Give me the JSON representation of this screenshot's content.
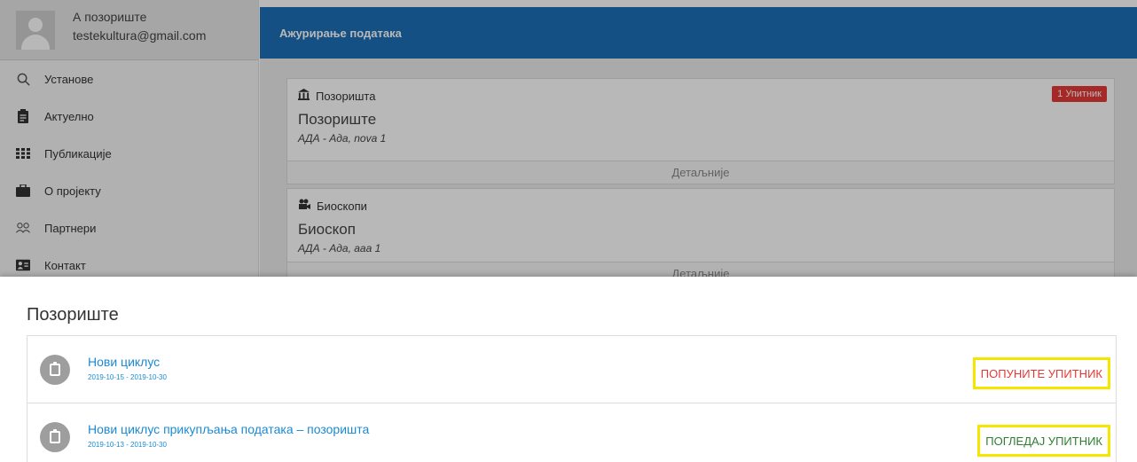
{
  "profile": {
    "name": "А позориште",
    "email": "testekultura@gmail.com"
  },
  "sidebar": {
    "items": [
      {
        "label": "Установе",
        "icon": "search-icon"
      },
      {
        "label": "Актуелно",
        "icon": "clipboard-icon"
      },
      {
        "label": "Публикације",
        "icon": "grid-icon"
      },
      {
        "label": "О пројекту",
        "icon": "briefcase-icon"
      },
      {
        "label": "Партнери",
        "icon": "people-icon"
      },
      {
        "label": "Контакт",
        "icon": "contact-card-icon"
      }
    ]
  },
  "header": {
    "title": "Ажурирање података"
  },
  "cards": [
    {
      "category": "Позоришта",
      "category_icon": "theater-icon",
      "name": "Позориште",
      "address": "АДА - Ада, nova 1",
      "badge": "1 Упитник",
      "more_label": "Детаљније"
    },
    {
      "category": "Биоскопи",
      "category_icon": "film-icon",
      "name": "Биоскоп",
      "address": "АДА - Ада, ааа 1",
      "more_label": "Детаљније"
    }
  ],
  "sheet": {
    "title": "Позориште",
    "rows": [
      {
        "title": "Нови циклус",
        "dates": "2019-10-15 - 2019-10-30",
        "action": "ПОПУНИТЕ УПИТНИК"
      },
      {
        "title": "Нови циклус прикупљања података – позоришта",
        "dates": "2019-10-13 - 2019-10-30",
        "action": "ПОГЛЕДАЈ УПИТНИК"
      }
    ]
  },
  "colors": {
    "header": "#1e6fb8",
    "link": "#1a8ad4",
    "action_fill": "#e53935",
    "action_view": "#2e7d32",
    "highlight": "#f5e600"
  }
}
